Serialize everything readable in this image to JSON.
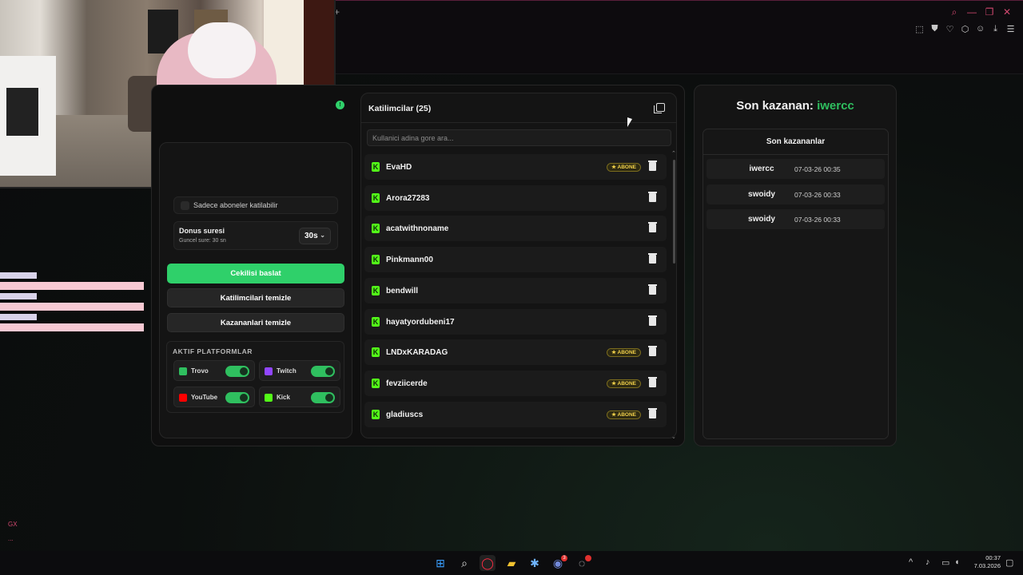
{
  "browser": {
    "new_tab_glyph": "+",
    "window_controls": [
      "search-icon",
      "minimize-icon",
      "restore-icon",
      "close-icon"
    ],
    "toolbar_icons": [
      "snapshot-icon",
      "shield-icon",
      "heart-icon",
      "extensions-icon",
      "account-icon",
      "download-icon",
      "menu-icon"
    ]
  },
  "overlay_chat": {
    "side_label": "GX",
    "side_more": "..."
  },
  "left_panel": {
    "subscribers_only_label": "Sadece aboneler katilabilir",
    "duration_title": "Donus suresi",
    "duration_current": "Guncel sure: 30 sn",
    "duration_value": "30s",
    "start_button": "Cekilisi baslat",
    "clear_participants_button": "Katilimcilari temizle",
    "clear_winners_button": "Kazananlari temizle",
    "platforms_title": "AKTIF PLATFORMLAR",
    "platforms": [
      {
        "name": "Trovo",
        "enabled": true,
        "color": "#2fbf5f"
      },
      {
        "name": "Twitch",
        "enabled": true,
        "color": "#9146ff"
      },
      {
        "name": "YouTube",
        "enabled": true,
        "color": "#ff0000"
      },
      {
        "name": "Kick",
        "enabled": true,
        "color": "#53fc18"
      }
    ]
  },
  "participants": {
    "header": "Katilimcilar (25)",
    "search_placeholder": "Kullanici adina gore ara...",
    "badge_label": "ABONE",
    "rows": [
      {
        "name": "EvaHD",
        "subscriber": true
      },
      {
        "name": "Arora27283",
        "subscriber": false
      },
      {
        "name": "acatwithnoname",
        "subscriber": false
      },
      {
        "name": "Pinkmann00",
        "subscriber": false
      },
      {
        "name": "bendwill",
        "subscriber": false
      },
      {
        "name": "hayatyordubeni17",
        "subscriber": false
      },
      {
        "name": "LNDxKARADAG",
        "subscriber": true
      },
      {
        "name": "fevziicerde",
        "subscriber": true
      },
      {
        "name": "gladiuscs",
        "subscriber": true
      }
    ]
  },
  "winners": {
    "title_prefix": "Son kazanan:",
    "last_winner": "iwercc",
    "list_title": "Son kazananlar",
    "rows": [
      {
        "name": "iwercc",
        "time": "07-03-26 00:35"
      },
      {
        "name": "swoidy",
        "time": "07-03-26 00:33"
      },
      {
        "name": "swoidy",
        "time": "07-03-26 00:33"
      }
    ]
  },
  "taskbar": {
    "tray_arrow": "^",
    "time": "00:37",
    "date": "7.03.2026",
    "discord_badge": "3"
  }
}
